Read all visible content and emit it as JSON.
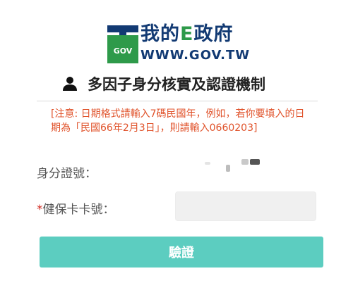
{
  "logo": {
    "title_prefix": "我的",
    "title_letter": "E",
    "title_suffix": "政府",
    "url": "WWW.GOV.TW",
    "emblem_text": "GOV"
  },
  "header": {
    "title": "多因子身分核實及認證機制",
    "icon": "user-icon"
  },
  "notice": {
    "text": "[注意: 日期格式請輸入7碼民國年，例如，若你要填入的日期為「民國66年2月3日」，則請輸入0660203]"
  },
  "form": {
    "id_label": "身分證號：",
    "card_label": "健保卡卡號：",
    "required_mark": "*",
    "card_value": "",
    "card_placeholder": ""
  },
  "actions": {
    "verify_label": "驗證"
  },
  "colors": {
    "brand_navy": "#123a73",
    "brand_green": "#2e9a4a",
    "notice": "#e0522a",
    "button": "#5ccdc0",
    "required": "#d0241b"
  }
}
